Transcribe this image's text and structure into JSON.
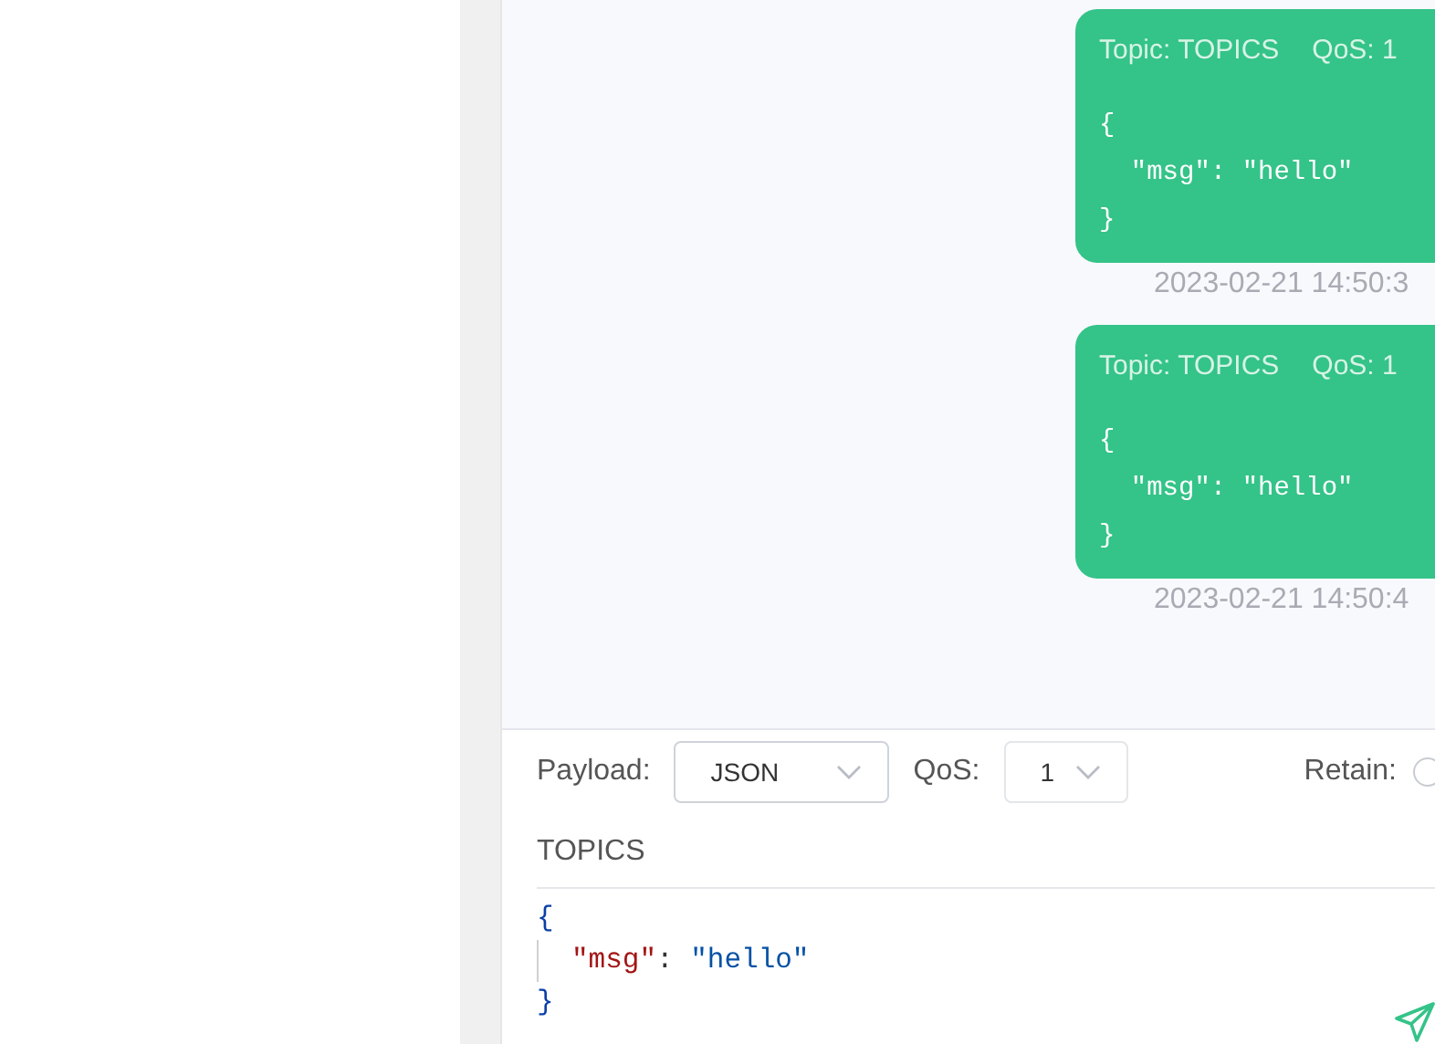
{
  "messages": [
    {
      "topic_label": "Topic: TOPICS",
      "qos_label": "QoS: 1",
      "payload_lines": [
        "{",
        "  \"msg\": \"hello\"",
        "}"
      ],
      "time": "2023-02-21 14:50:3"
    },
    {
      "topic_label": "Topic: TOPICS",
      "qos_label": "QoS: 1",
      "payload_lines": [
        "{",
        "  \"msg\": \"hello\"",
        "}"
      ],
      "time": "2023-02-21 14:50:4"
    }
  ],
  "composer": {
    "payload_label": "Payload:",
    "payload_format": "JSON",
    "qos_label": "QoS:",
    "qos_value": "1",
    "retain": {
      "label": "Retain:",
      "checked": false
    },
    "topic": "TOPICS",
    "editor_lines": [
      [
        {
          "kind": "brace",
          "text": "{"
        }
      ],
      [
        {
          "kind": "key",
          "text": "\"msg\""
        },
        {
          "kind": "plain",
          "text": ": "
        },
        {
          "kind": "string",
          "text": "\"hello\""
        }
      ],
      [
        {
          "kind": "brace",
          "text": "}"
        }
      ]
    ]
  }
}
